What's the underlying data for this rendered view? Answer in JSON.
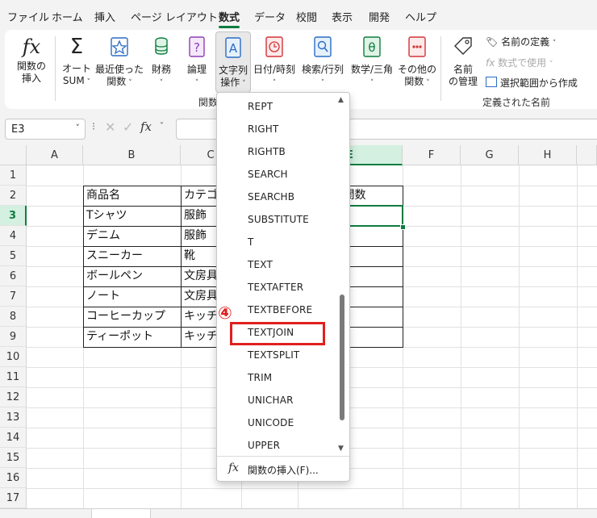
{
  "menu": {
    "tabs": [
      "ファイル",
      "ホーム",
      "挿入",
      "ページ レイアウト",
      "数式",
      "データ",
      "校閲",
      "表示",
      "開発",
      "ヘルプ"
    ],
    "active_tab": "数式"
  },
  "ribbon": {
    "buttons": {
      "insert_function": "関数の\n挿入",
      "autosum_line1": "オート",
      "autosum_line2": "SUM",
      "recent_line1": "最近使った",
      "recent_line2": "関数",
      "financial": "財務",
      "logical": "論理",
      "text_line1": "文字列",
      "text_line2": "操作",
      "datetime": "日付/時刻",
      "lookup": "検索/行列",
      "math": "数学/三角",
      "more_line1": "その他の",
      "more_line2": "関数",
      "name_manager_line1": "名前",
      "name_manager_line2": "の管理",
      "define_name": "名前の定義",
      "use_in_formula": "数式で使用",
      "create_from_selection": "選択範囲から作成"
    },
    "group_labels": {
      "function_library": "関数",
      "defined_names": "定義された名前"
    }
  },
  "formula_bar": {
    "name_box": "E3",
    "formula": ""
  },
  "columns": [
    "A",
    "B",
    "C",
    "D",
    "E",
    "F",
    "G",
    "H"
  ],
  "rows": [
    "1",
    "2",
    "3",
    "4",
    "5",
    "6",
    "7",
    "8",
    "9",
    "10",
    "11",
    "12",
    "13",
    "14",
    "15",
    "16",
    "17"
  ],
  "table": {
    "header": [
      "商品名",
      "カテゴ",
      "",
      "N関数"
    ],
    "rows": [
      [
        "Tシャツ",
        "服飾"
      ],
      [
        "デニム",
        "服飾"
      ],
      [
        "スニーカー",
        "靴"
      ],
      [
        "ボールペン",
        "文房具"
      ],
      [
        "ノート",
        "文房具"
      ],
      [
        "コーヒーカップ",
        "キッチ"
      ],
      [
        "ティーポット",
        "キッチ"
      ]
    ]
  },
  "dropdown": {
    "items": [
      "REPT",
      "RIGHT",
      "RIGHTB",
      "SEARCH",
      "SEARCHB",
      "SUBSTITUTE",
      "T",
      "TEXT",
      "TEXTAFTER",
      "TEXTBEFORE",
      "TEXTJOIN",
      "TEXTSPLIT",
      "TRIM",
      "UNICHAR",
      "UNICODE",
      "UPPER"
    ],
    "highlighted": "TEXTJOIN",
    "insert_function": "関数の挿入(F)...",
    "insert_icon": "fx"
  },
  "annotation": {
    "step": "④",
    "color": "#e0201d"
  },
  "colors": {
    "accent": "#107c41",
    "annotation_red": "#e0201d"
  }
}
